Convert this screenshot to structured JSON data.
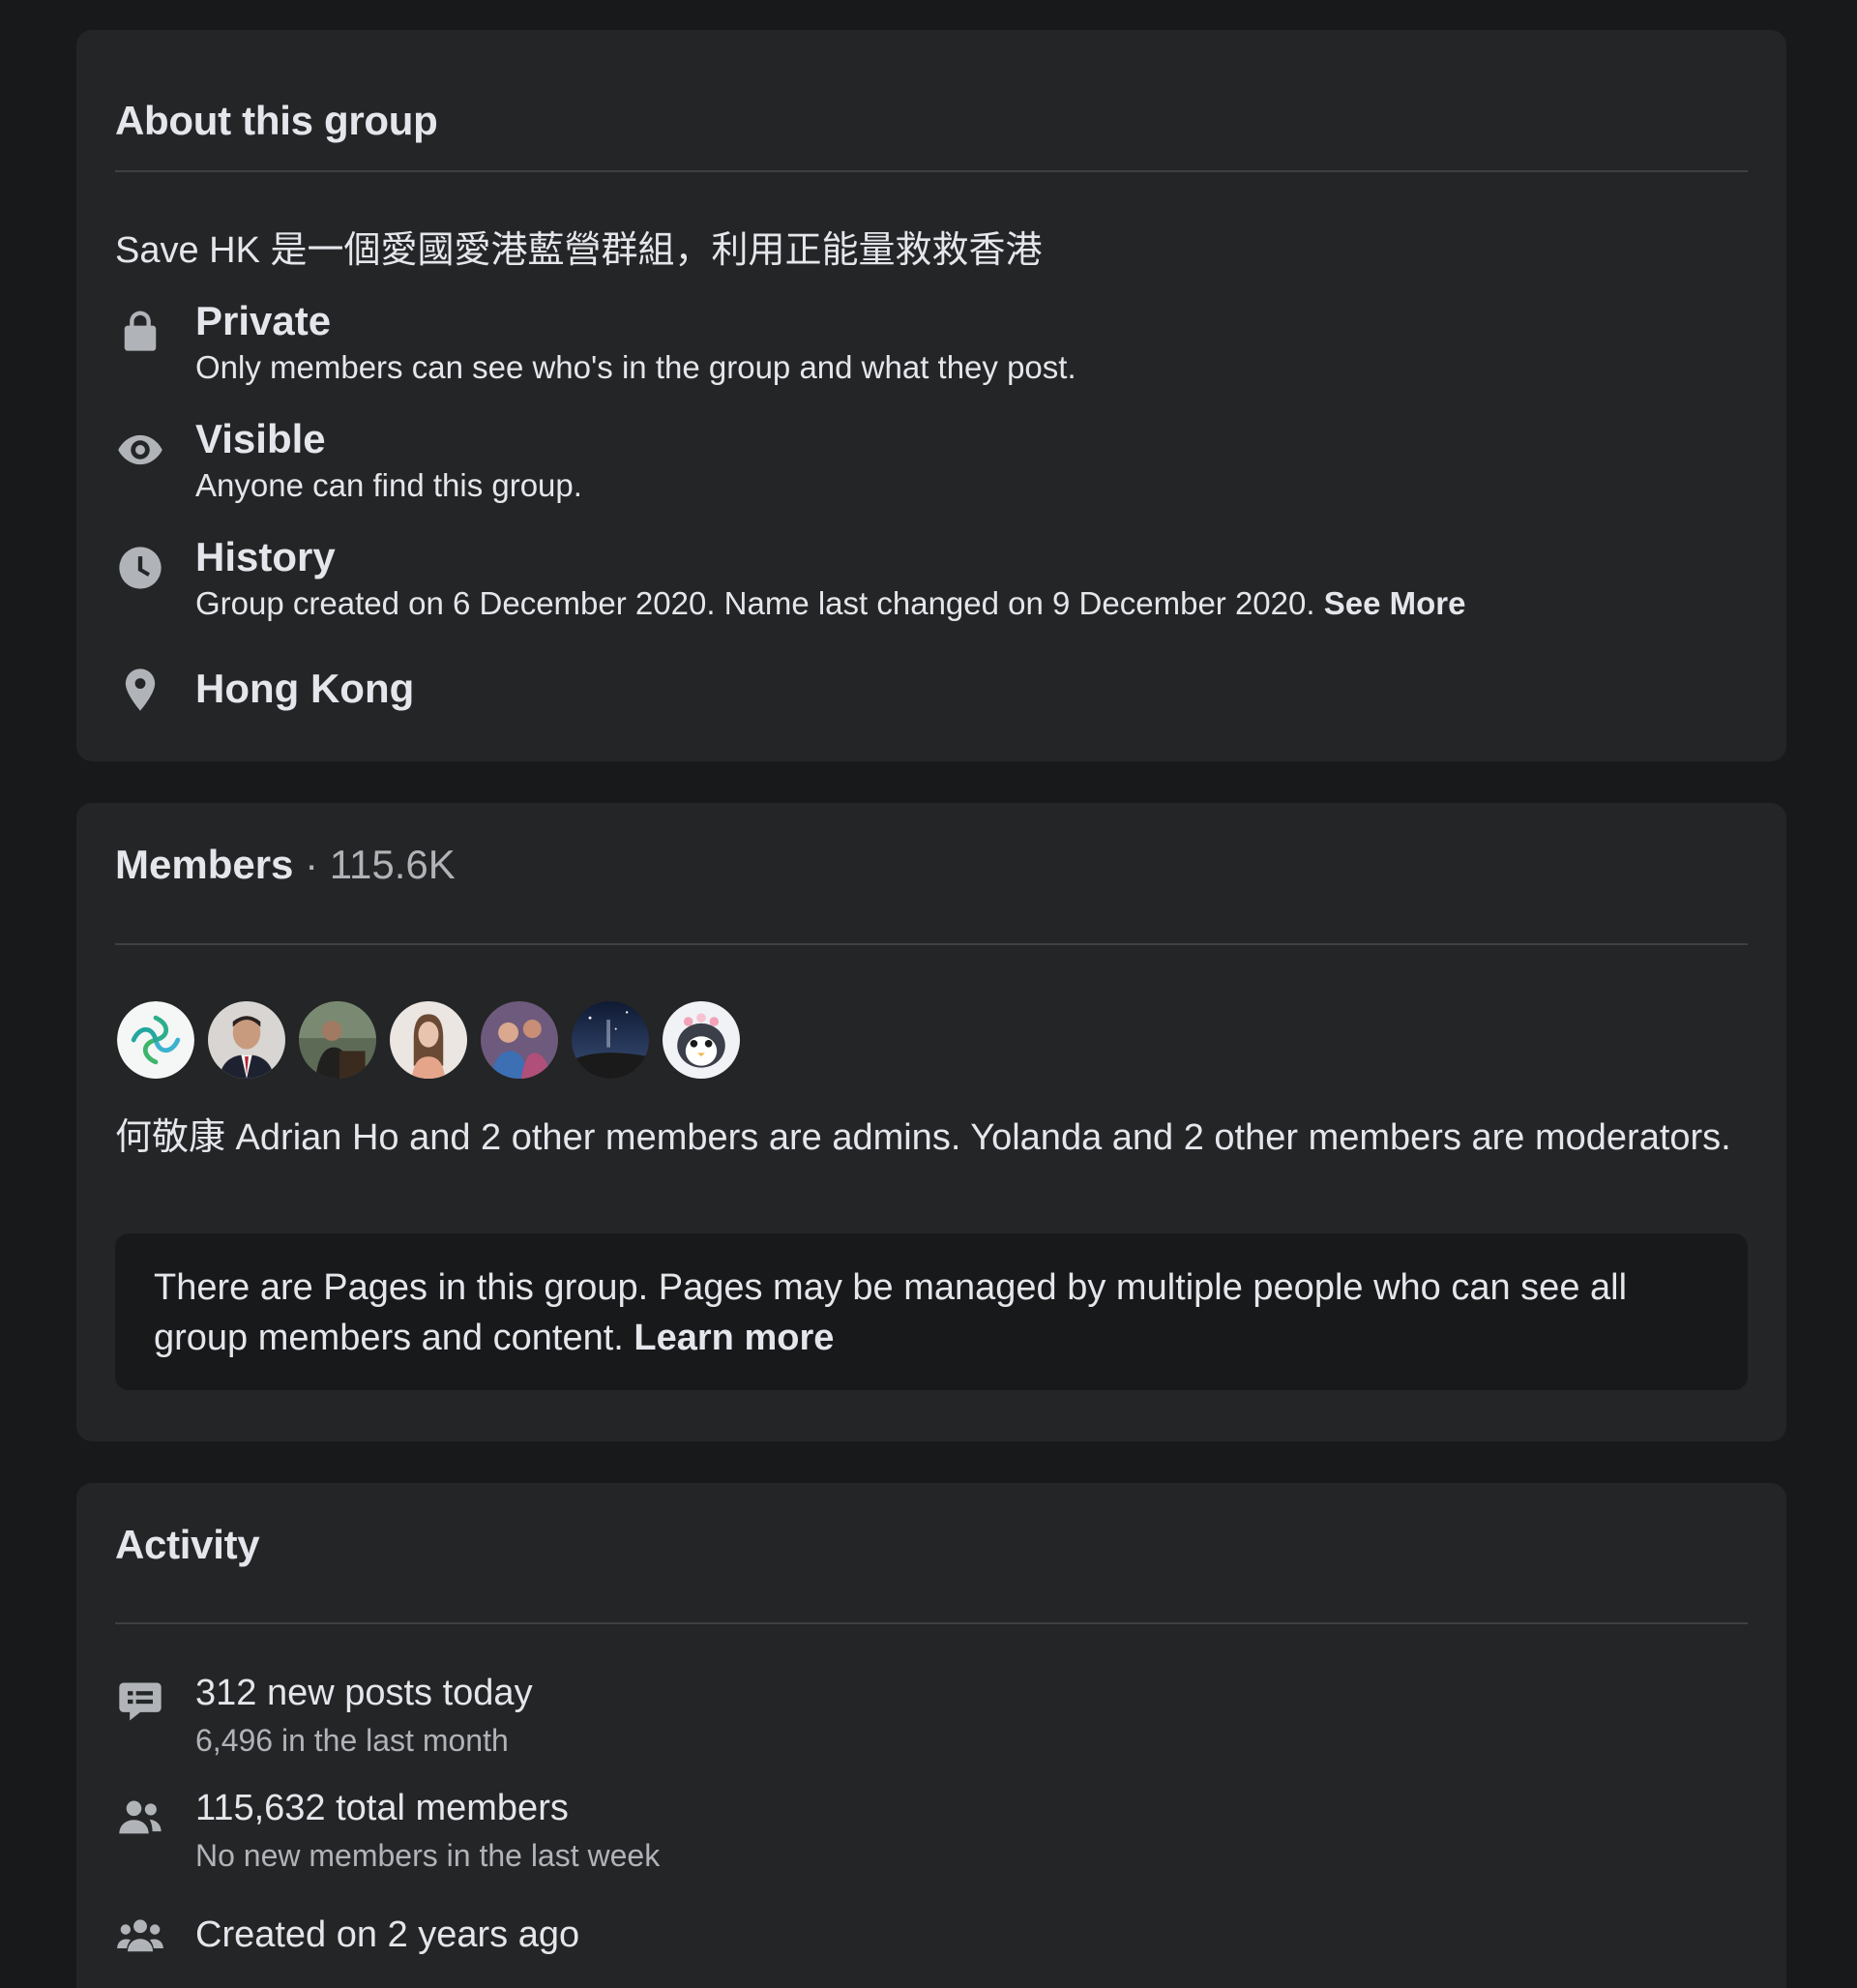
{
  "about": {
    "title": "About this group",
    "description": "Save HK 是一個愛國愛港藍營群組，利用正能量救救香港",
    "private": {
      "icon": "lock-icon",
      "title": "Private",
      "subtitle": "Only members can see who's in the group and what they post."
    },
    "visible": {
      "icon": "eye-icon",
      "title": "Visible",
      "subtitle": "Anyone can find this group."
    },
    "history": {
      "icon": "clock-icon",
      "title": "History",
      "subtitle": "Group created on 6 December 2020. Name last changed on 9 December 2020.",
      "see_more": "See More"
    },
    "location": {
      "icon": "map-pin-icon",
      "title": "Hong Kong"
    }
  },
  "members": {
    "label": "Members",
    "separator": " · ",
    "count": "115.6K",
    "avatars": [
      "avatar-1",
      "avatar-2",
      "avatar-3",
      "avatar-4",
      "avatar-5",
      "avatar-6",
      "avatar-7"
    ],
    "admins_text": "何敬康 Adrian Ho and 2 other members are admins. Yolanda and 2 other members are moderators.",
    "notice_text": "There are Pages in this group. Pages may be managed by multiple people who can see all group members and content.",
    "notice_link": "Learn more"
  },
  "activity": {
    "title": "Activity",
    "posts": {
      "icon": "chat-bubble-icon",
      "title": "312 new posts today",
      "subtitle": "6,496 in the last month"
    },
    "total_members": {
      "icon": "people-icon",
      "title": "115,632 total members",
      "subtitle": "No new members in the last week"
    },
    "created": {
      "icon": "group-icon",
      "title": "Created on 2 years ago"
    }
  },
  "colors": {
    "background": "#18191a",
    "card": "#242526",
    "text_primary": "#e4e6eb",
    "text_secondary": "#b0b3b8",
    "icon": "#b0b3b8",
    "divider": "#3e4042"
  }
}
